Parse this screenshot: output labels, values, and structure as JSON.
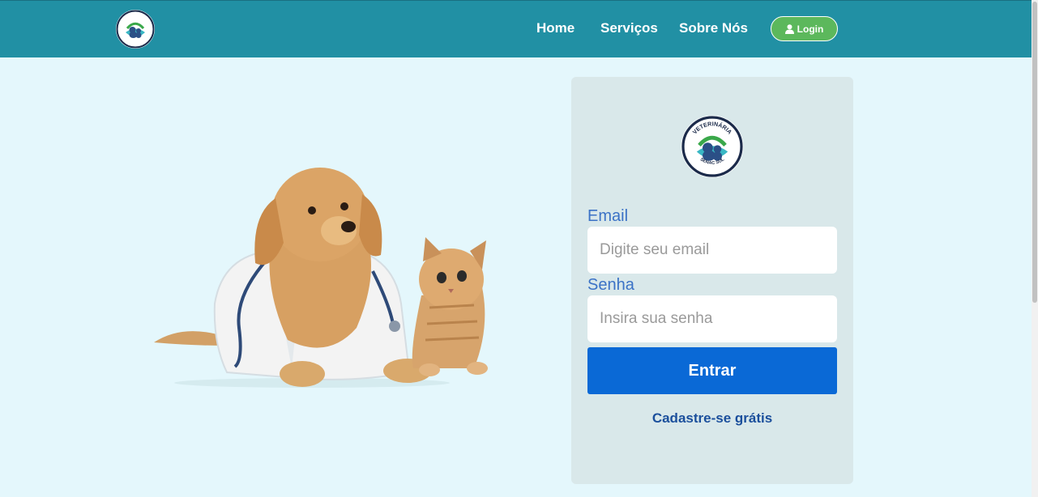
{
  "navbar": {
    "logo": {
      "icon": "vet-logo-icon",
      "text_top": "VETERINÁRIA",
      "text_bottom": "SENAC SUL"
    },
    "links": [
      {
        "label": "Home"
      },
      {
        "label": "Serviços"
      },
      {
        "label": "Sobre Nós"
      }
    ],
    "login_button": {
      "label": "Login",
      "icon": "user-icon",
      "color": "#5cb85c"
    },
    "background": "#2190a4"
  },
  "hero": {
    "image": "dog-and-cat-illustration"
  },
  "login_card": {
    "logo": {
      "icon": "vet-logo-icon",
      "text_top": "VETERINÁRIA",
      "text_bottom": "SENAC SUL"
    },
    "email": {
      "label": "Email",
      "placeholder": "Digite seu email"
    },
    "password": {
      "label": "Senha",
      "placeholder": "Insira sua senha"
    },
    "submit_label": "Entrar",
    "signup_link": "Cadastre-se grátis",
    "accent": "#0a69d6"
  }
}
